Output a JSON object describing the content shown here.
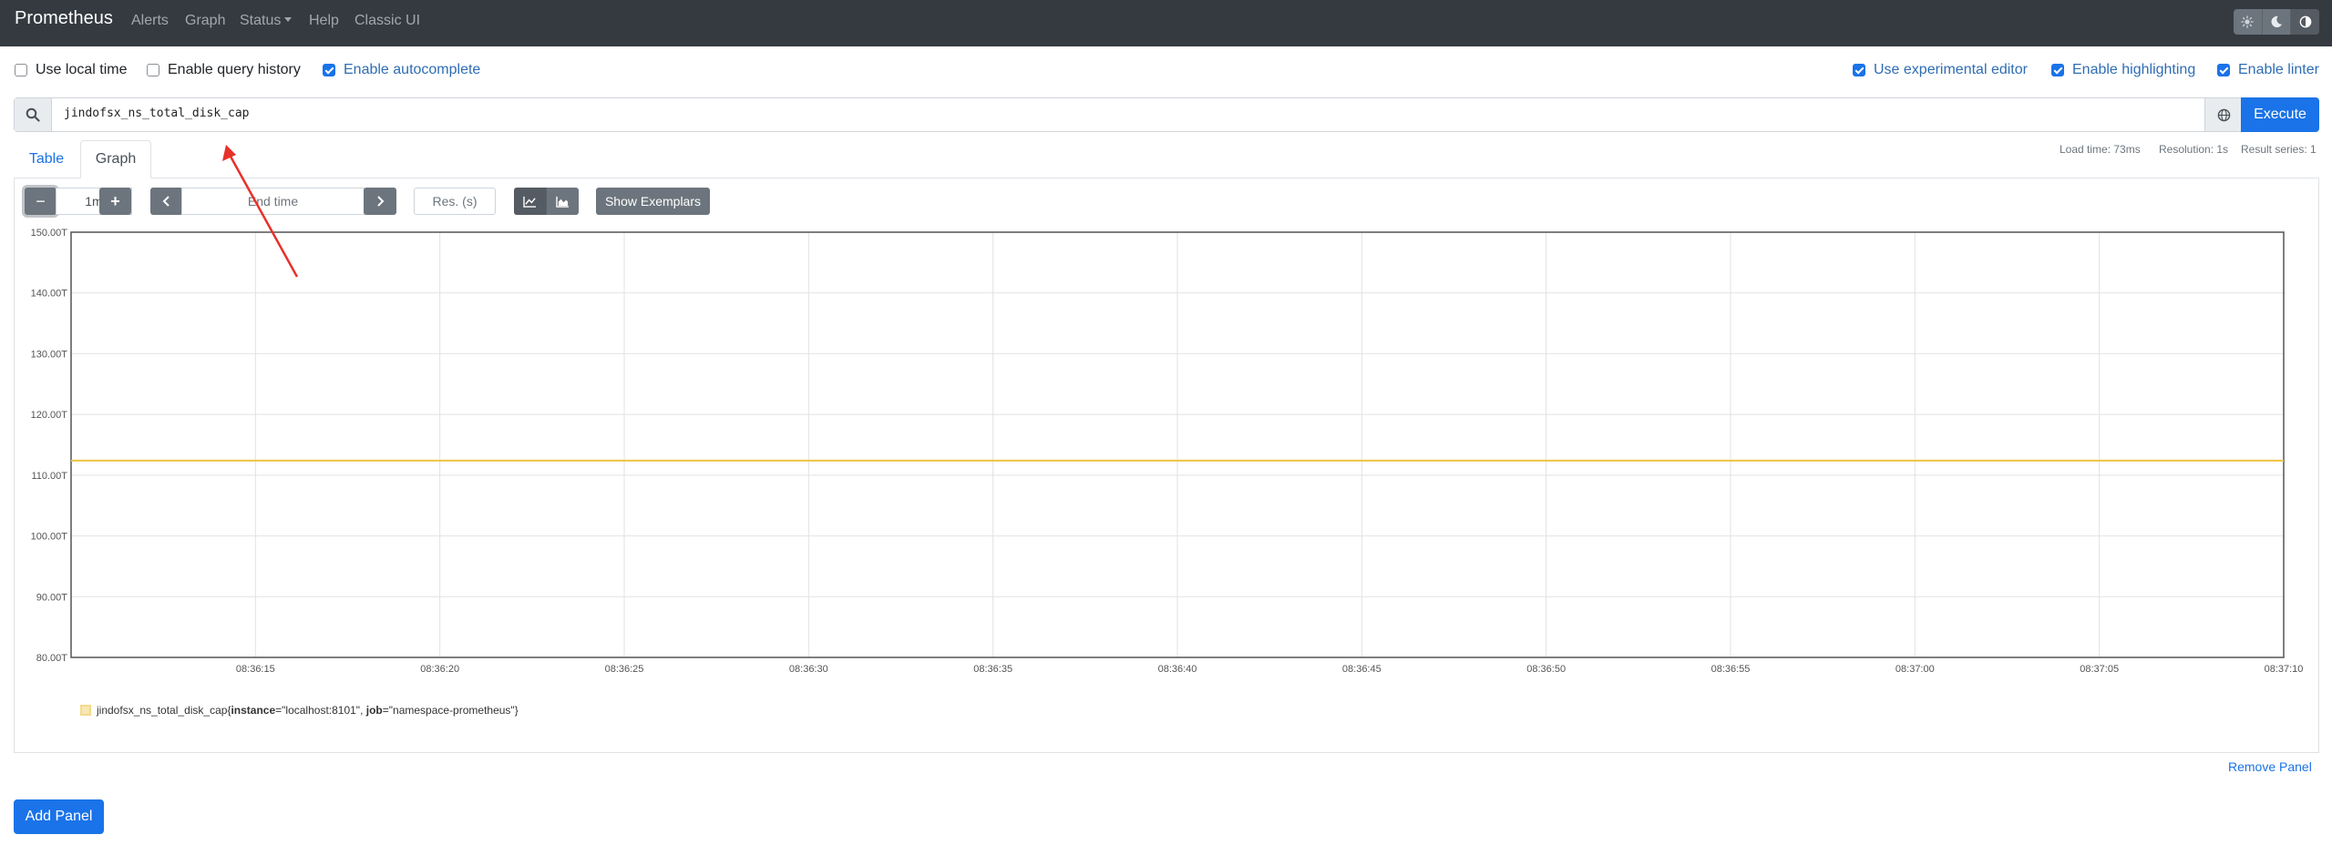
{
  "navbar": {
    "brand": "Prometheus",
    "links": [
      {
        "label": "Alerts"
      },
      {
        "label": "Graph"
      },
      {
        "label": "Status"
      },
      {
        "label": "Help"
      },
      {
        "label": "Classic UI"
      }
    ],
    "theme_icons": [
      "sun-icon",
      "moon-icon",
      "contrast-icon"
    ]
  },
  "options": {
    "use_local_time": {
      "label": "Use local time",
      "checked": false
    },
    "enable_query_history": {
      "label": "Enable query history",
      "checked": false
    },
    "enable_autocomplete": {
      "label": "Enable autocomplete",
      "checked": true
    },
    "use_experimental_editor": {
      "label": "Use experimental editor",
      "checked": true
    },
    "enable_highlighting": {
      "label": "Enable highlighting",
      "checked": true
    },
    "enable_linter": {
      "label": "Enable linter",
      "checked": true
    }
  },
  "query": {
    "expression": "jindofsx_ns_total_disk_cap",
    "execute_label": "Execute",
    "accent_color": "#1a73e8"
  },
  "tabs": [
    {
      "label": "Table",
      "active": false
    },
    {
      "label": "Graph",
      "active": true
    }
  ],
  "stats": {
    "load_time": "Load time: 73ms",
    "resolution": "Resolution: 1s",
    "result_series": "Result series: 1"
  },
  "graph_controls": {
    "decrease_label": "−",
    "range": "1m",
    "increase_label": "+",
    "end_time_placeholder": "End time",
    "resolution_placeholder": "Res. (s)",
    "show_exemplars_label": "Show Exemplars"
  },
  "chart_data": {
    "type": "line",
    "y_ticks": [
      "80.00T",
      "90.00T",
      "100.00T",
      "110.00T",
      "120.00T",
      "130.00T",
      "140.00T",
      "150.00T"
    ],
    "ylim": [
      80,
      150
    ],
    "y_unit": "T",
    "x_ticks": [
      "08:36:15",
      "08:36:20",
      "08:36:25",
      "08:36:30",
      "08:36:35",
      "08:36:40",
      "08:36:45",
      "08:36:50",
      "08:36:55",
      "08:37:00",
      "08:37:05",
      "08:37:10"
    ],
    "x_range_seconds": [
      970,
      1030
    ],
    "grid": true,
    "series": [
      {
        "metric": "jindofsx_ns_total_disk_cap",
        "labels": [
          {
            "key": "instance",
            "value": "\"localhost:8101\""
          },
          {
            "key": "job",
            "value": "\"namespace-prometheus\""
          }
        ],
        "color": "#edc240",
        "x_seconds": [
          970,
          1030
        ],
        "values": [
          112.4,
          112.4
        ]
      }
    ]
  },
  "footer": {
    "remove_panel_label": "Remove Panel",
    "add_panel_label": "Add Panel"
  }
}
